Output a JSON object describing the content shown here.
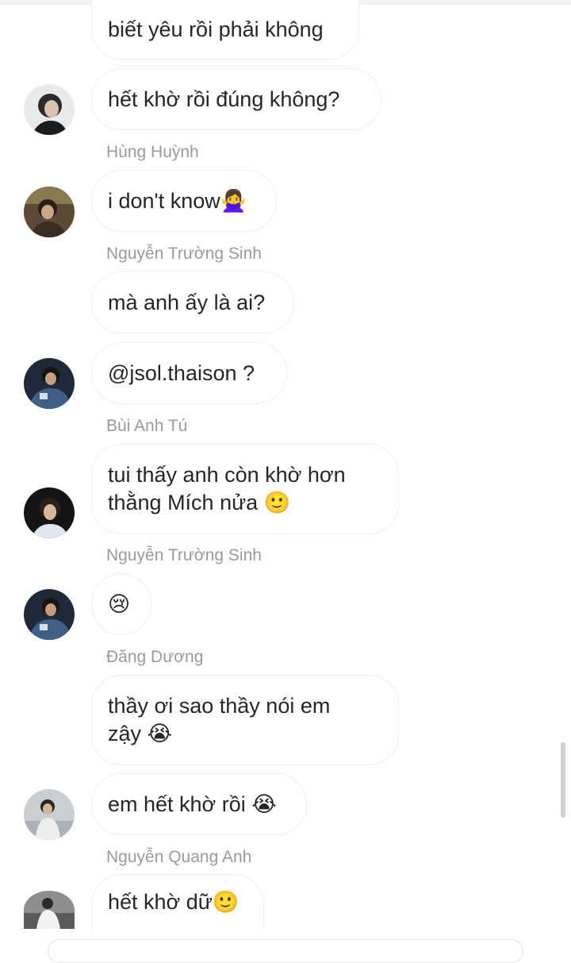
{
  "messages": [
    {
      "id": "m1",
      "text": "biết yêu rồi phải không"
    },
    {
      "id": "m2",
      "text": "hết khờ rồi đúng không?"
    },
    {
      "id": "m3",
      "sender": "Hùng Huỳnh",
      "text": "i don't know🙅‍♀️"
    },
    {
      "id": "m4",
      "sender": "Nguyễn Trường Sinh",
      "text": "mà anh ấy là ai?"
    },
    {
      "id": "m5",
      "text": "@jsol.thaison ?"
    },
    {
      "id": "m6",
      "sender": "Bùi Anh Tú",
      "text": "tui thấy anh còn khờ hơn\nthằng Mích nửa 🙂"
    },
    {
      "id": "m7",
      "sender": "Nguyễn Trường Sinh",
      "text": "😢"
    },
    {
      "id": "m8",
      "sender": "Đăng Dương",
      "text": "thầy ơi sao thầy nói em\nzậy 😭"
    },
    {
      "id": "m9",
      "text": "em hết khờ rồi 😭"
    },
    {
      "id": "m10",
      "sender": "Nguyễn Quang Anh",
      "text": "hết khờ dữ🙂"
    }
  ],
  "colors": {
    "bubble_border": "#efefef",
    "sender_name": "#9a9a9a",
    "message_text": "#262626"
  }
}
